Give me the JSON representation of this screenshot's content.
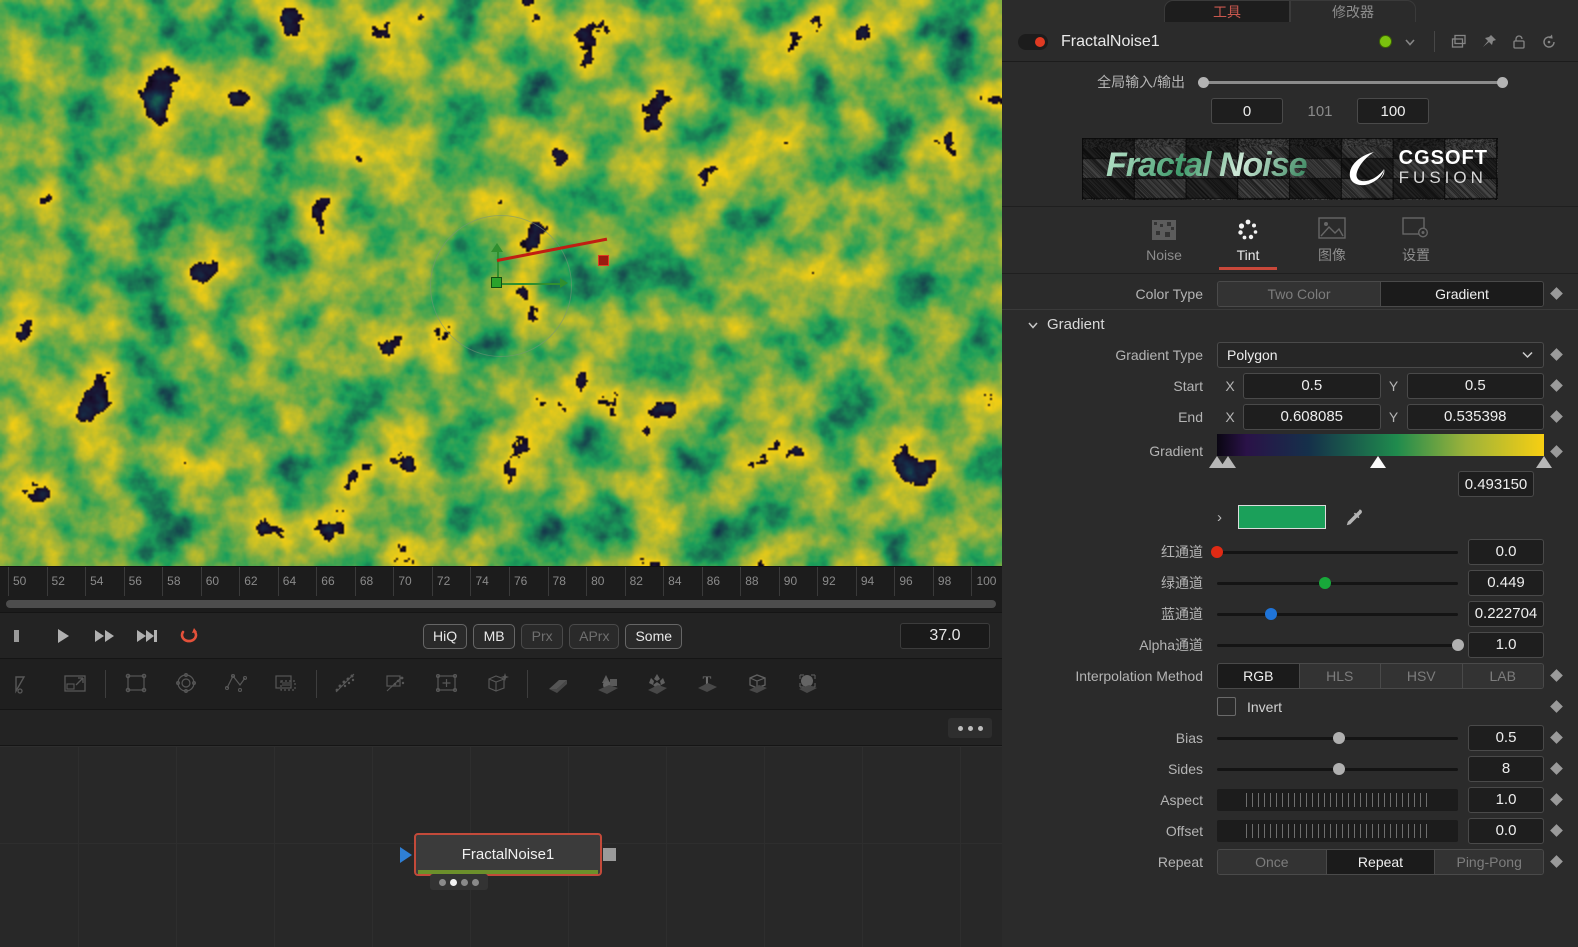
{
  "viewer": {
    "osd": {
      "name": "gradient-onscreen-widget"
    }
  },
  "timeline": {
    "ticks": [
      50,
      52,
      54,
      56,
      58,
      60,
      62,
      64,
      66,
      68,
      70,
      72,
      74,
      76,
      78,
      80,
      82,
      84,
      86,
      88,
      90,
      92,
      94,
      96,
      98,
      100
    ],
    "playhead_label": "100"
  },
  "transport": {
    "buttons": [
      "step-back",
      "play",
      "fast-forward",
      "skip-to-end",
      "loop"
    ],
    "quality": [
      {
        "label": "HiQ",
        "active": true
      },
      {
        "label": "MB",
        "active": true
      },
      {
        "label": "Prx",
        "active": false
      },
      {
        "label": "APrx",
        "active": false
      },
      {
        "label": "Some",
        "active": true
      }
    ],
    "current_frame": "37.0"
  },
  "toolbar": {
    "icons": [
      "render-out",
      "resize-out",
      "rectangle-mask",
      "ellipse-mask",
      "polyline-mask",
      "bitmap-mask",
      "particle-emitter",
      "particle-render",
      "particle-region",
      "camera3d",
      "image-plane3d",
      "shape3d",
      "replicate3d",
      "text3d",
      "fbx-mesh3d",
      "sphere3d"
    ]
  },
  "nodegraph": {
    "overflow_menu": "more-options",
    "node": {
      "label": "FractalNoise1",
      "selected": true
    }
  },
  "inspector": {
    "tabs": [
      {
        "label": "工具",
        "active": true
      },
      {
        "label": "修改器",
        "active": false
      }
    ],
    "tool_header": {
      "name": "FractalNoise1",
      "enabled": true,
      "status": "ok",
      "icons": [
        "chevron-down-icon",
        "layers-icon",
        "pin-icon",
        "lock-icon",
        "reset-icon"
      ]
    },
    "global_range": {
      "label": "全局输入/输出",
      "in": "0",
      "mid": "101",
      "out": "100"
    },
    "banner": {
      "title": "Fractal Noise",
      "brand_line1": "CGSOFT",
      "brand_line2": "FUSION"
    },
    "page_tabs": [
      {
        "label": "Noise",
        "icon": "noise-icon",
        "active": false
      },
      {
        "label": "Tint",
        "icon": "tint-icon",
        "active": true
      },
      {
        "label": "图像",
        "icon": "image-icon",
        "active": false
      },
      {
        "label": "设置",
        "icon": "settings-icon",
        "active": false
      }
    ],
    "color_type": {
      "label": "Color Type",
      "options": [
        {
          "label": "Two Color",
          "active": false
        },
        {
          "label": "Gradient",
          "active": true
        }
      ]
    },
    "gradient_section": {
      "title": "Gradient",
      "gradient_type": {
        "label": "Gradient Type",
        "value": "Polygon"
      },
      "start": {
        "label": "Start",
        "x_axis": "X",
        "x": "0.5",
        "y_axis": "Y",
        "y": "0.5"
      },
      "end": {
        "label": "End",
        "x_axis": "X",
        "x": "0.608085",
        "y_axis": "Y",
        "y": "0.535398"
      },
      "gradient": {
        "label": "Gradient",
        "stops": [
          {
            "pos": 0.0,
            "color": "#0a0612",
            "selected": false
          },
          {
            "pos": 0.035,
            "color": "#1a0e2c",
            "selected": false
          },
          {
            "pos": 0.493,
            "color": "#1ba05a",
            "selected": true
          },
          {
            "pos": 1.0,
            "color": "#f7cf12",
            "selected": false
          }
        ]
      },
      "selected_stop_position": "0.493150",
      "selected_color": "#1ba05a",
      "channels": [
        {
          "label": "红通道",
          "value": "0.0",
          "pos": 0.0,
          "knob": "red"
        },
        {
          "label": "绿通道",
          "value": "0.449",
          "pos": 0.449,
          "knob": "green"
        },
        {
          "label": "蓝通道",
          "value": "0.222704",
          "pos": 0.2227,
          "knob": "blue"
        },
        {
          "label": "Alpha通道",
          "value": "1.0",
          "pos": 1.0,
          "knob": "alpha"
        }
      ],
      "interpolation": {
        "label": "Interpolation Method",
        "options": [
          {
            "label": "RGB",
            "active": true
          },
          {
            "label": "HLS",
            "active": false
          },
          {
            "label": "HSV",
            "active": false
          },
          {
            "label": "LAB",
            "active": false
          }
        ]
      },
      "invert": {
        "label": "Invert",
        "checked": false
      },
      "bias": {
        "label": "Bias",
        "value": "0.5",
        "pos": 0.5
      },
      "sides": {
        "label": "Sides",
        "value": "8",
        "pos": 0.5
      },
      "aspect": {
        "label": "Aspect",
        "value": "1.0"
      },
      "offset": {
        "label": "Offset",
        "value": "0.0"
      },
      "repeat": {
        "label": "Repeat",
        "options": [
          {
            "label": "Once",
            "active": false
          },
          {
            "label": "Repeat",
            "active": true
          },
          {
            "label": "Ping-Pong",
            "active": false
          }
        ]
      }
    }
  },
  "colors": {
    "accent_red": "#c9483a",
    "status_green": "#7ac20e",
    "node_border": "#c34a3a",
    "node_bar": "#6c8f2b"
  }
}
